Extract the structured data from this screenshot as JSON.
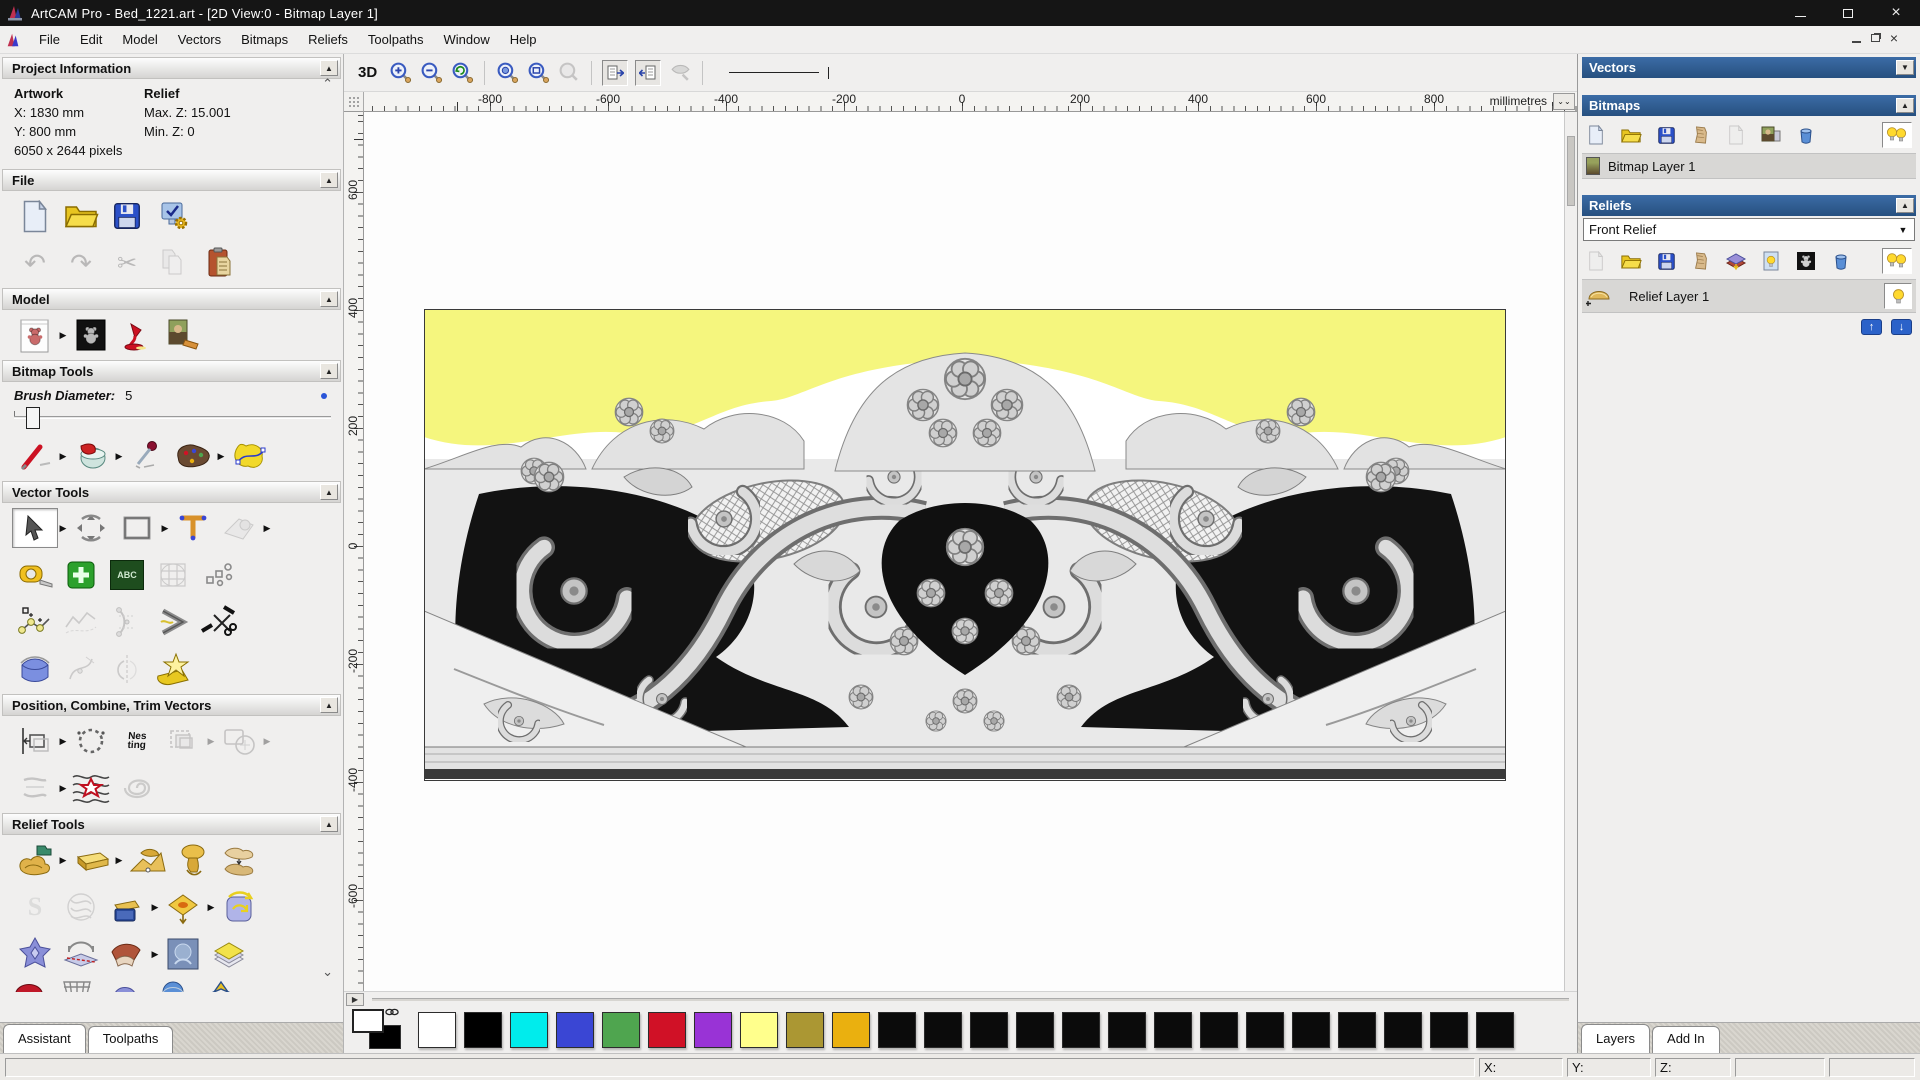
{
  "window": {
    "title": "ArtCAM Pro - Bed_1221.art - [2D View:0 - Bitmap Layer 1]"
  },
  "menu": {
    "items": [
      "File",
      "Edit",
      "Model",
      "Vectors",
      "Bitmaps",
      "Reliefs",
      "Toolpaths",
      "Window",
      "Help"
    ]
  },
  "assistant": {
    "project_information": {
      "title": "Project Information",
      "artwork_heading": "Artwork",
      "artwork_x": "X: 1830 mm",
      "artwork_y": "Y: 800 mm",
      "artwork_pixels": "6050 x 2644 pixels",
      "relief_heading": "Relief",
      "relief_max": "Max. Z: 15.001",
      "relief_min": "Min. Z: 0"
    },
    "sections": {
      "file": "File",
      "model": "Model",
      "bitmap_tools": "Bitmap Tools",
      "vector_tools": "Vector Tools",
      "position_combine": "Position, Combine, Trim Vectors",
      "relief_tools": "Relief Tools"
    },
    "brush": {
      "label": "Brush Diameter:",
      "value": "5"
    },
    "abc_label": "ABC",
    "nesting_label": "Nes ting",
    "s_swirl_label": "S",
    "tabs": [
      "Assistant",
      "Toolpaths"
    ]
  },
  "canvas": {
    "toolbar": {
      "view_3d": "3D"
    },
    "hruler": [
      "-800",
      "-600",
      "-400",
      "-200",
      "0",
      "200",
      "400",
      "600",
      "800"
    ],
    "unit": "millimetres",
    "vruler": [
      "600",
      "400",
      "200",
      "0",
      "-200",
      "-400",
      "-600"
    ]
  },
  "right_panel": {
    "vectors_title": "Vectors",
    "bitmaps_title": "Bitmaps",
    "bitmap_layer": "Bitmap Layer 1",
    "reliefs_title": "Reliefs",
    "relief_set": "Front Relief",
    "relief_layer": "Relief Layer 1",
    "tabs": [
      "Layers",
      "Add In"
    ]
  },
  "palette": {
    "swatches": [
      "#ffffff",
      "#000000",
      "#00ecec",
      "#3a46d4",
      "#4fa54f",
      "#d01126",
      "#9933d6",
      "#ffff8c",
      "#ab9733",
      "#eab00f",
      "#0b0b0b",
      "#0b0b0b",
      "#0b0b0b",
      "#0b0b0b",
      "#0b0b0b",
      "#0b0b0b",
      "#0b0b0b",
      "#0b0b0b",
      "#0b0b0b",
      "#0b0b0b",
      "#0b0b0b",
      "#0b0b0b",
      "#0b0b0b",
      "#0b0b0b"
    ]
  },
  "statusbar": {
    "x_label": "X:",
    "y_label": "Y:",
    "z_label": "Z:"
  },
  "glyphs": {
    "flyout": "▶",
    "collapse_up": "▲",
    "dropdown": "▼",
    "undo": "↶",
    "redo": "↷",
    "cut": "✂",
    "scroll_up": "⌃",
    "scroll_down": "⌄",
    "double_down": "⌄⌄",
    "pan_right": "▶",
    "up": "↑",
    "down": "↓",
    "close": "×"
  },
  "colors": {
    "header_blue": "#2d5b92",
    "artwork_yellow": "#f5f67e",
    "selection_gray": "#d8d7d5"
  }
}
